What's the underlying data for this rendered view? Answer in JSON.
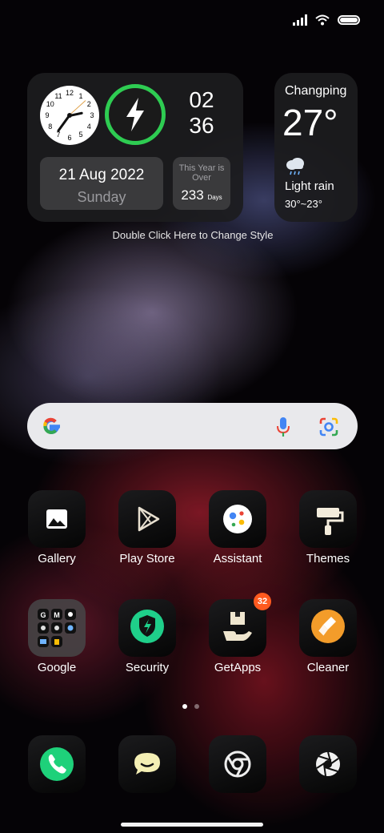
{
  "status_bar": {
    "signal": "signal-icon",
    "wifi": "wifi-icon",
    "battery": "battery-icon"
  },
  "clock_widget": {
    "time_hours": "02",
    "time_minutes": "36",
    "date": "21 Aug 2022",
    "weekday": "Sunday",
    "year_over_label": "This Year is Over",
    "days_value": "233",
    "days_unit": "Days",
    "clock_numbers": [
      "12",
      "1",
      "2",
      "3",
      "4",
      "5",
      "6",
      "7",
      "8",
      "9",
      "10",
      "11"
    ],
    "charge_ring_color": "#2ecc52"
  },
  "weather_widget": {
    "city": "Changping",
    "temperature": "27°",
    "condition": "Light rain",
    "range": "30°~23°",
    "icon": "rain-cloud-icon"
  },
  "hint_text": "Double Click Here to Change Style",
  "search_bar": {
    "logo": "google-g-icon",
    "mic": "mic-icon",
    "lens": "lens-icon"
  },
  "apps_row1": [
    {
      "label": "Gallery",
      "icon": "gallery-icon"
    },
    {
      "label": "Play Store",
      "icon": "play-store-icon"
    },
    {
      "label": "Assistant",
      "icon": "assistant-icon"
    },
    {
      "label": "Themes",
      "icon": "themes-icon"
    }
  ],
  "apps_row2": [
    {
      "label": "Google",
      "icon": "google-folder-icon"
    },
    {
      "label": "Security",
      "icon": "security-icon"
    },
    {
      "label": "GetApps",
      "icon": "getapps-icon",
      "badge": "32"
    },
    {
      "label": "Cleaner",
      "icon": "cleaner-icon"
    }
  ],
  "page_indicator": {
    "pages": 2,
    "current": 1
  },
  "dock": [
    {
      "icon": "phone-icon"
    },
    {
      "icon": "messaging-icon"
    },
    {
      "icon": "chrome-icon"
    },
    {
      "icon": "camera-icon"
    }
  ],
  "colors": {
    "accent_green": "#2ecc52",
    "badge_orange": "#ff5a1f",
    "google_blue": "#4285f4",
    "google_red": "#ea4335",
    "google_yellow": "#fbbc05",
    "google_green": "#34a853"
  }
}
